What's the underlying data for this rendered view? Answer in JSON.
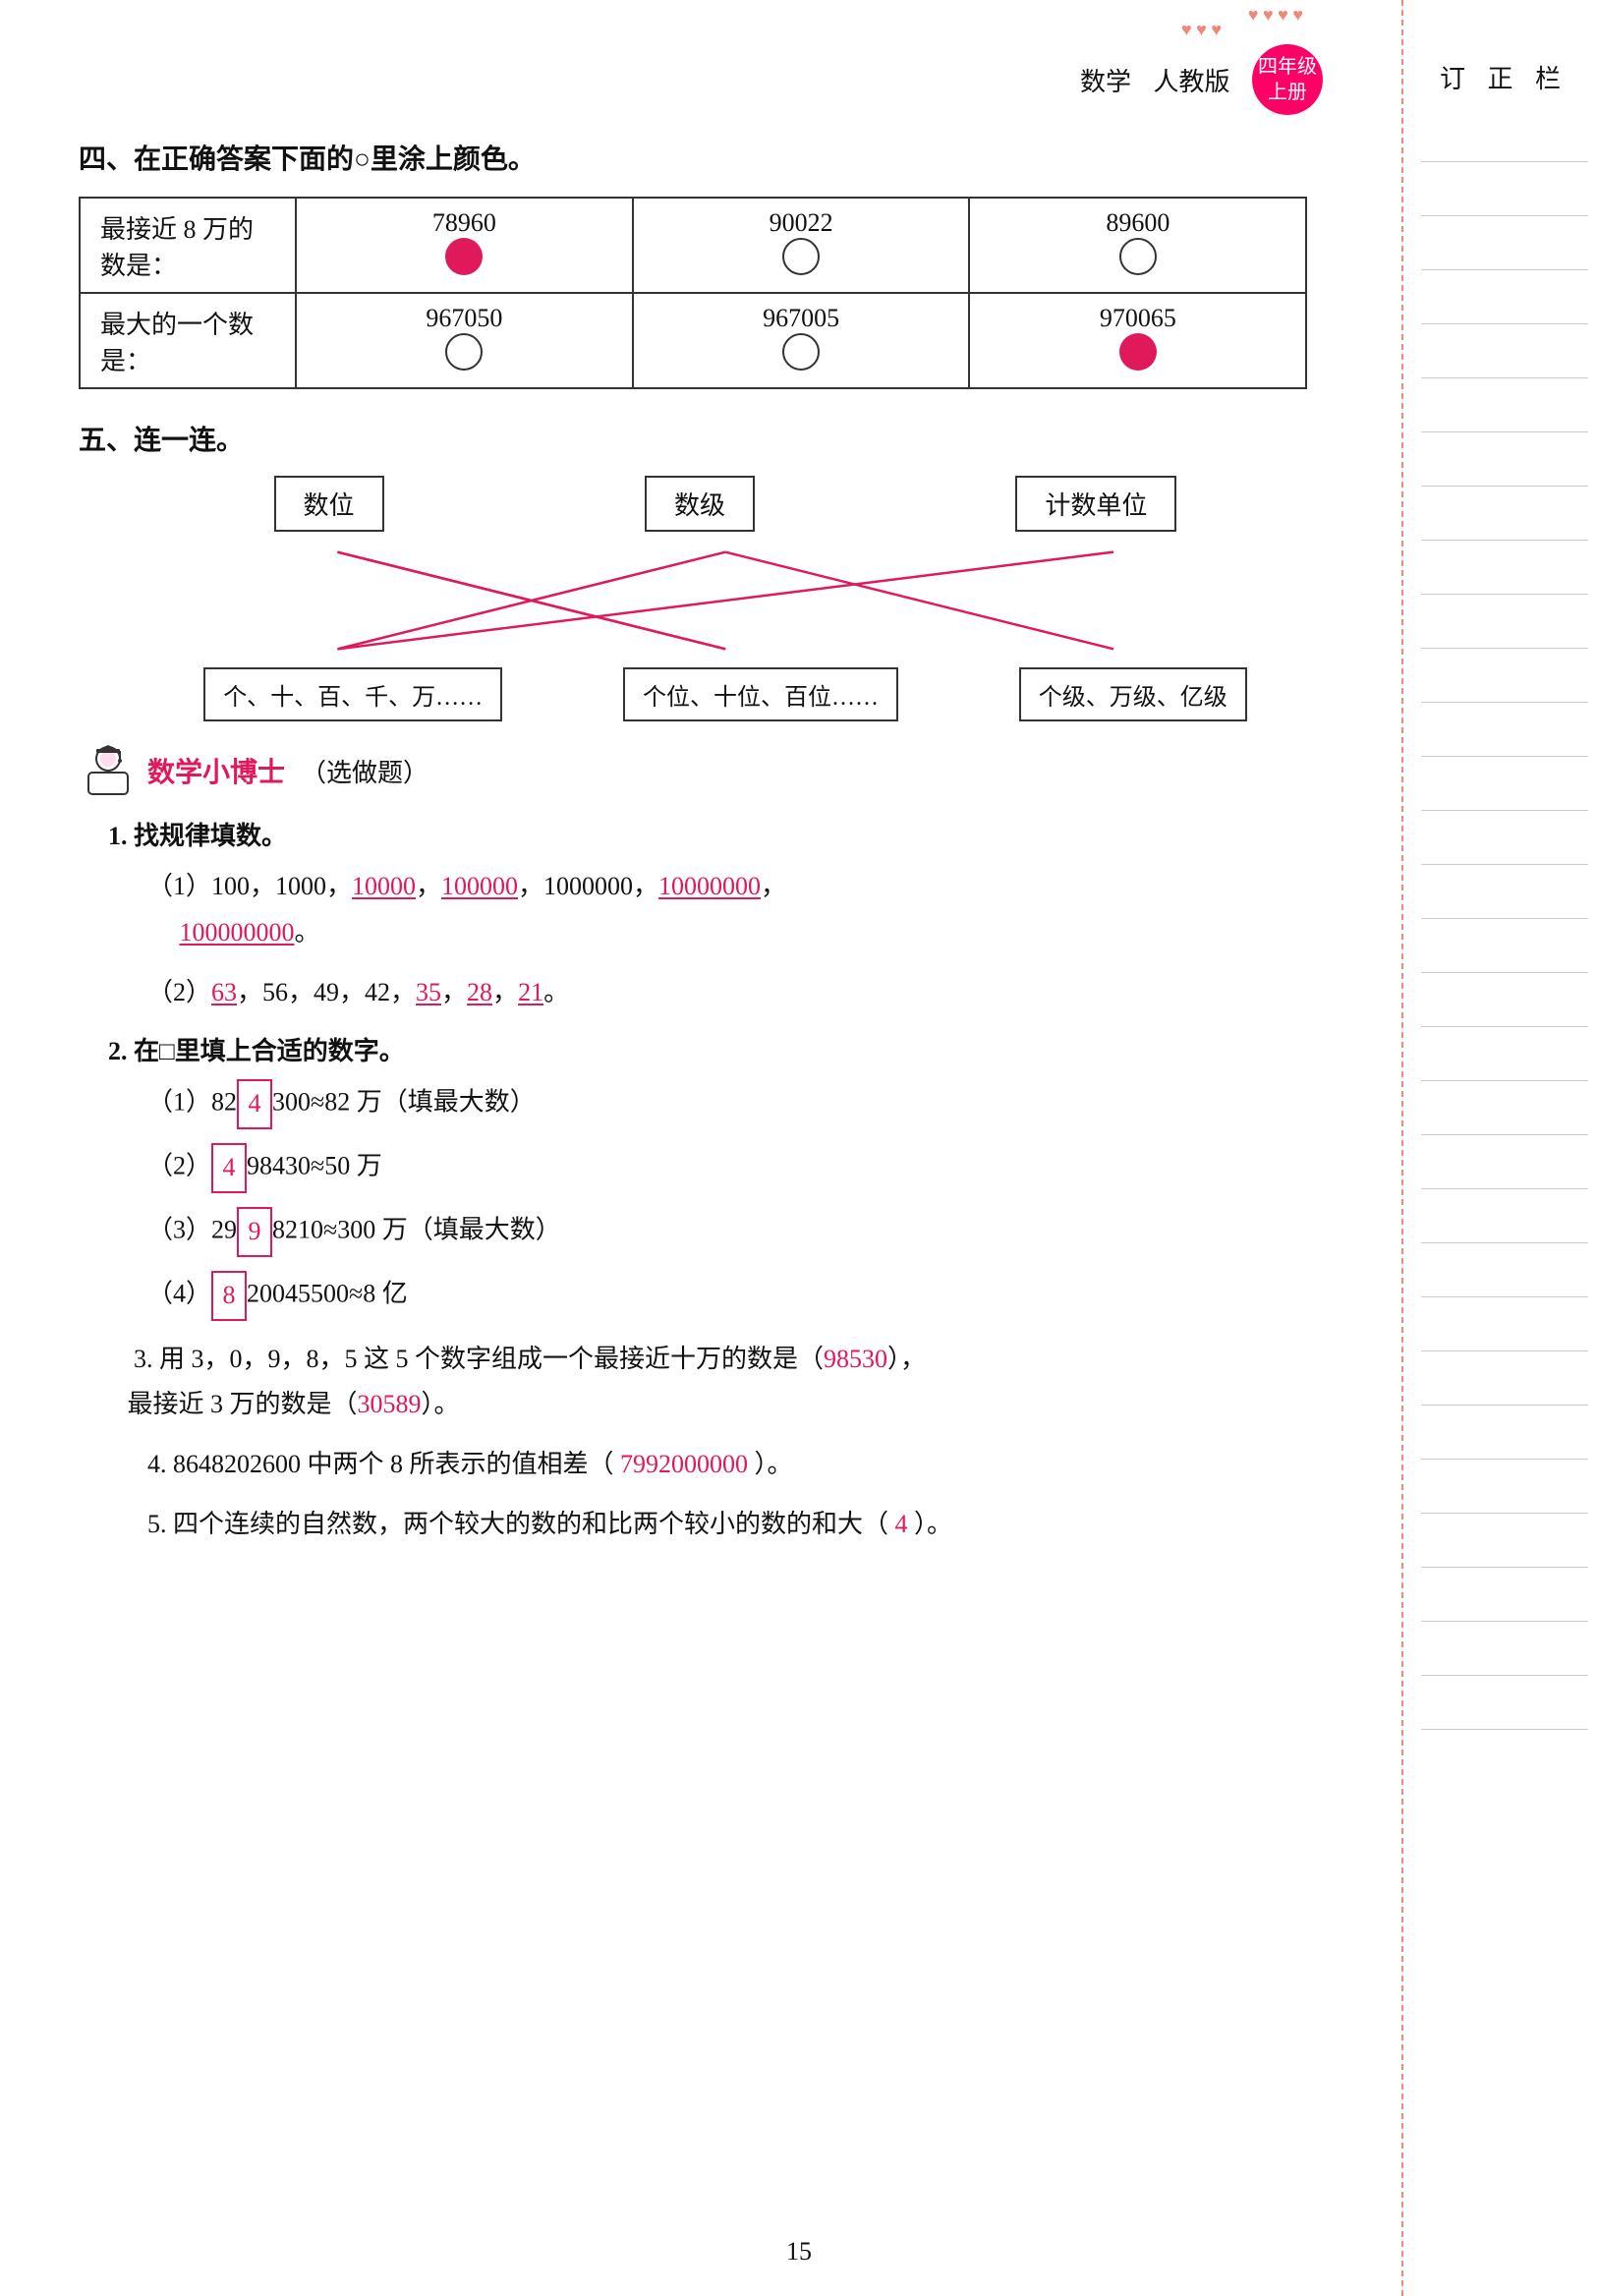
{
  "header": {
    "subject": "数学",
    "publisher": "人教版",
    "grade_line1": "四年级",
    "grade_line2": "上册"
  },
  "correction": {
    "title": "订 正 栏"
  },
  "section4": {
    "title": "四、在正确答案下面的○里涂上颜色。",
    "rows": [
      {
        "label": "最接近 8 万的数是：",
        "options": [
          {
            "value": "78960",
            "filled": true
          },
          {
            "value": "90022",
            "filled": false
          },
          {
            "value": "89600",
            "filled": false
          }
        ]
      },
      {
        "label": "最大的一个数是：",
        "options": [
          {
            "value": "967050",
            "filled": false
          },
          {
            "value": "967005",
            "filled": false
          },
          {
            "value": "970065",
            "filled": true
          }
        ]
      }
    ]
  },
  "section5": {
    "title": "五、连一连。",
    "top_boxes": [
      "数位",
      "数级",
      "计数单位"
    ],
    "bottom_boxes": [
      "个、十、百、千、万……",
      "个位、十位、百位……",
      "个级、万级、亿级"
    ]
  },
  "doctor_section": {
    "title": "数学小博士",
    "subtitle": "（选做题）",
    "problems": [
      {
        "num": "1.",
        "label": "找规律填数。",
        "items": [
          {
            "id": "1-1",
            "text_before": "（1）100，1000，",
            "answers": [
              "10000"
            ],
            "text_mid": "，",
            "answers2": [
              "100000"
            ],
            "text_mid2": "，1000000，",
            "answers3": [
              "10000000"
            ],
            "text_mid3": "，",
            "newline": true,
            "answers4": [
              "100000000"
            ],
            "text_end": "。"
          },
          {
            "id": "1-2",
            "text_before": "（2）",
            "answers": [
              "63"
            ],
            "text_mid": "，56，49，42，",
            "answers2": [
              "35"
            ],
            "text_mid2": "，",
            "answers3": [
              "28"
            ],
            "text_mid3": "，",
            "answers4": [
              "21"
            ],
            "text_end": "。"
          }
        ]
      },
      {
        "num": "2.",
        "label": "在□里填上合适的数字。",
        "items": [
          {
            "id": "2-1",
            "text_before": "（1）82",
            "box_value": "4",
            "text_after": "300≈82 万（填最大数）"
          },
          {
            "id": "2-2",
            "text_before": "（2）",
            "box_value": "4",
            "text_after": "98430≈50 万"
          },
          {
            "id": "2-3",
            "text_before": "（3）29",
            "box_value": "9",
            "text_after": "8210≈300 万（填最大数）"
          },
          {
            "id": "2-4",
            "text_before": "（4）",
            "box_value": "8",
            "text_after": "20045500≈8 亿"
          }
        ]
      },
      {
        "num": "3.",
        "text": "用 3，0，9，8，5 这 5 个数字组成一个最接近十万的数是（",
        "answer1": "98530",
        "text_mid": "），",
        "text2": "最接近 3 万的数是（",
        "answer2": "30589",
        "text_end": "）。"
      },
      {
        "num": "4.",
        "text": "8648202600 中两个 8 所表示的值相差（",
        "answer": "7992000000",
        "text_end": "）。"
      },
      {
        "num": "5.",
        "text": "四个连续的自然数，两个较大的数的和比两个较小的数的和大（",
        "answer": "4",
        "text_end": "）。"
      }
    ]
  },
  "page_number": "15"
}
